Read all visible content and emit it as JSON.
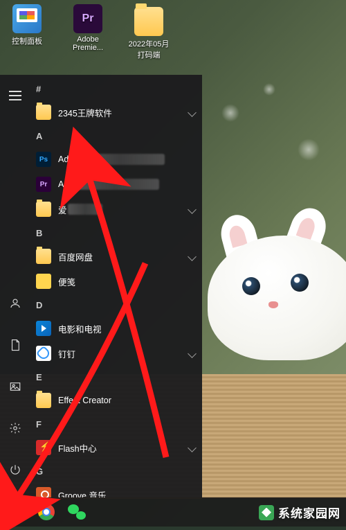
{
  "desktop_icons": [
    {
      "name": "control-panel",
      "label": "控制面板"
    },
    {
      "name": "adobe-premiere",
      "label": "Adobe\nPremie..."
    },
    {
      "name": "folder-202205",
      "label": "2022年05月\n打码端"
    }
  ],
  "start_menu": {
    "headers": {
      "hash": "#",
      "A": "A",
      "B": "B",
      "D": "D",
      "E": "E",
      "F": "F",
      "G": "G"
    },
    "items": {
      "i0": {
        "label": "2345王牌软件",
        "expandable": true
      },
      "i1": {
        "label": "Ado"
      },
      "i2": {
        "label": "Ad"
      },
      "i3": {
        "label": "爱",
        "expandable": true
      },
      "i4": {
        "label": "百度网盘",
        "expandable": true
      },
      "i5": {
        "label": "便笺"
      },
      "i6": {
        "label": "电影和电视"
      },
      "i7": {
        "label": "钉钉",
        "expandable": true
      },
      "i8": {
        "label": "Effect Creator"
      },
      "i9": {
        "label": "Flash中心",
        "expandable": true
      },
      "i10": {
        "label": "Groove 音乐"
      }
    }
  },
  "watermark": "系统家园网"
}
